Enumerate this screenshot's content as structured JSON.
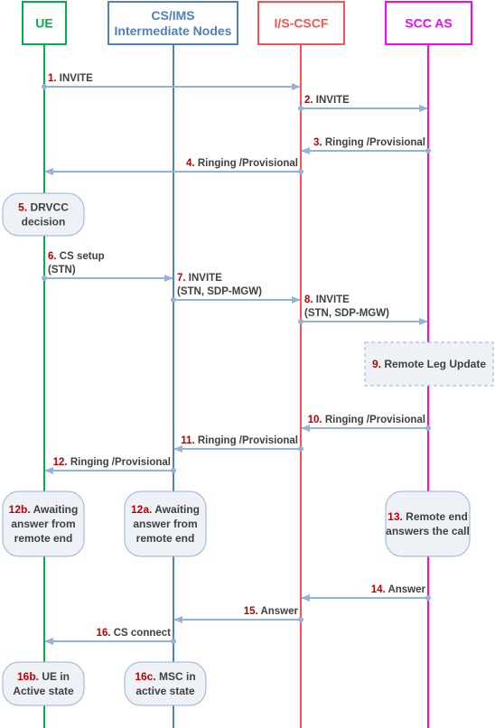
{
  "colors": {
    "ue": "#00b050",
    "cs_ims": "#4f81bd",
    "iscscf": "#ff5050",
    "sccas": "#ff00ff",
    "arrow": "#95b3d7",
    "step_number": "#c00000",
    "text": "#404040",
    "box_fill": "#eef1f6",
    "box_border": "#95b3d7"
  },
  "participants": [
    {
      "id": "ue",
      "lines": [
        "UE"
      ]
    },
    {
      "id": "cs_ims",
      "lines": [
        "CS/IMS",
        "Intermediate Nodes"
      ]
    },
    {
      "id": "iscscf",
      "lines": [
        "I/S-CSCF"
      ]
    },
    {
      "id": "sccas",
      "lines": [
        "SCC AS"
      ]
    }
  ],
  "messages": [
    {
      "num": "1.",
      "lines": [
        "INVITE"
      ],
      "from": "ue",
      "to": "iscscf"
    },
    {
      "num": "2.",
      "lines": [
        "INVITE"
      ],
      "from": "iscscf",
      "to": "sccas"
    },
    {
      "num": "3.",
      "lines": [
        "Ringing /Provisional"
      ],
      "from": "sccas",
      "to": "iscscf"
    },
    {
      "num": "4.",
      "lines": [
        "Ringing /Provisional"
      ],
      "from": "iscscf",
      "to": "ue"
    },
    {
      "num": "6.",
      "lines": [
        "CS setup",
        "(STN)"
      ],
      "from": "ue",
      "to": "cs_ims"
    },
    {
      "num": "7.",
      "lines": [
        "INVITE",
        "(STN, SDP-MGW)"
      ],
      "from": "cs_ims",
      "to": "iscscf"
    },
    {
      "num": "8.",
      "lines": [
        "INVITE",
        "(STN, SDP-MGW)"
      ],
      "from": "iscscf",
      "to": "sccas"
    },
    {
      "num": "10.",
      "lines": [
        "Ringing /Provisional"
      ],
      "from": "sccas",
      "to": "iscscf"
    },
    {
      "num": "11.",
      "lines": [
        "Ringing /Provisional"
      ],
      "from": "iscscf",
      "to": "cs_ims"
    },
    {
      "num": "12.",
      "lines": [
        "Ringing /Provisional"
      ],
      "from": "cs_ims",
      "to": "ue"
    },
    {
      "num": "14.",
      "lines": [
        "Answer"
      ],
      "from": "sccas",
      "to": "iscscf"
    },
    {
      "num": "15.",
      "lines": [
        "Answer"
      ],
      "from": "iscscf",
      "to": "cs_ims"
    },
    {
      "num": "16.",
      "lines": [
        "CS connect"
      ],
      "from": "cs_ims",
      "to": "ue"
    }
  ],
  "actions": [
    {
      "num": "5.",
      "lines": [
        "DRVCC",
        "decision"
      ],
      "on": "ue",
      "style": "rounded"
    },
    {
      "num": "9.",
      "lines": [
        "Remote Leg Update"
      ],
      "on": "sccas",
      "style": "dashed"
    },
    {
      "num": "12b.",
      "lines": [
        "Awaiting",
        "answer from",
        "remote end"
      ],
      "on": "ue",
      "style": "rounded"
    },
    {
      "num": "12a.",
      "lines": [
        "Awaiting",
        "answer from",
        "remote end"
      ],
      "on": "cs_ims",
      "style": "rounded"
    },
    {
      "num": "13.",
      "lines": [
        "Remote end",
        "answers the call"
      ],
      "on": "sccas",
      "style": "rounded"
    },
    {
      "num": "16b.",
      "lines": [
        "UE in",
        "Active state"
      ],
      "on": "ue",
      "style": "rounded"
    },
    {
      "num": "16c.",
      "lines": [
        "MSC in",
        "active state"
      ],
      "on": "cs_ims",
      "style": "rounded"
    }
  ]
}
